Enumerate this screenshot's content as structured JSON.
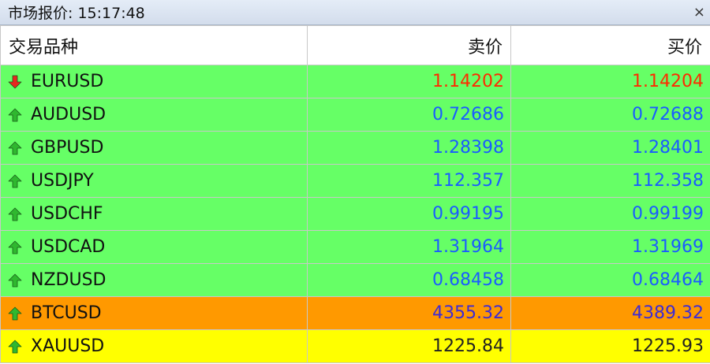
{
  "window": {
    "title": "市场报价: 15:17:48",
    "close_glyph": "×"
  },
  "table": {
    "headers": {
      "symbol": "交易品种",
      "bid": "卖价",
      "ask": "买价"
    },
    "rows": [
      {
        "symbol": "EURUSD",
        "bid": "1.14202",
        "ask": "1.14204",
        "direction": "down",
        "row_color": "#66ff66",
        "value_color": "#ff2a00"
      },
      {
        "symbol": "AUDUSD",
        "bid": "0.72686",
        "ask": "0.72688",
        "direction": "up",
        "row_color": "#66ff66",
        "value_color": "#1a5cff"
      },
      {
        "symbol": "GBPUSD",
        "bid": "1.28398",
        "ask": "1.28401",
        "direction": "up",
        "row_color": "#66ff66",
        "value_color": "#1a5cff"
      },
      {
        "symbol": "USDJPY",
        "bid": "112.357",
        "ask": "112.358",
        "direction": "up",
        "row_color": "#66ff66",
        "value_color": "#1a5cff"
      },
      {
        "symbol": "USDCHF",
        "bid": "0.99195",
        "ask": "0.99199",
        "direction": "up",
        "row_color": "#66ff66",
        "value_color": "#1a5cff"
      },
      {
        "symbol": "USDCAD",
        "bid": "1.31964",
        "ask": "1.31969",
        "direction": "up",
        "row_color": "#66ff66",
        "value_color": "#1a5cff"
      },
      {
        "symbol": "NZDUSD",
        "bid": "0.68458",
        "ask": "0.68464",
        "direction": "up",
        "row_color": "#66ff66",
        "value_color": "#1a5cff"
      },
      {
        "symbol": "BTCUSD",
        "bid": "4355.32",
        "ask": "4389.32",
        "direction": "up",
        "row_color": "#ff9900",
        "value_color": "#3d2bd6"
      },
      {
        "symbol": "XAUUSD",
        "bid": "1225.84",
        "ask": "1225.93",
        "direction": "up",
        "row_color": "#ffff00",
        "value_color": "#222222"
      }
    ]
  },
  "icons": {
    "up": "green-up-arrow-icon",
    "down": "red-down-arrow-icon"
  },
  "colors": {
    "arrow_up": "#2fb82f",
    "arrow_down": "#e8281f",
    "titlebar": "#d9e3f0"
  }
}
